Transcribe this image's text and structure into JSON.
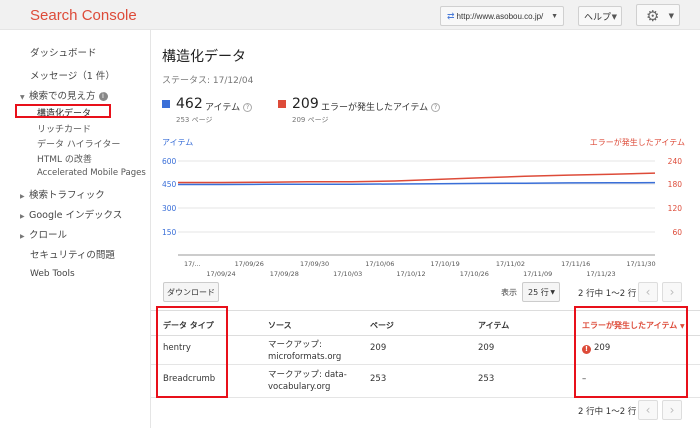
{
  "header": {
    "logo": "Search Console",
    "site": "http://www.asobou.co.jp/",
    "help": "ヘルプ"
  },
  "sidebar": {
    "items": [
      {
        "label": "ダッシュボード"
      },
      {
        "label": "メッセージ（1 件）"
      },
      {
        "label": "検索での見え方",
        "expanded": true
      },
      {
        "label": "構造化データ",
        "active": true
      },
      {
        "label": "リッチカード"
      },
      {
        "label": "データ ハイライター"
      },
      {
        "label": "HTML の改善"
      },
      {
        "label": "Accelerated Mobile Pages"
      },
      {
        "label": "検索トラフィック"
      },
      {
        "label": "Google インデックス"
      },
      {
        "label": "クロール"
      },
      {
        "label": "セキュリティの問題"
      },
      {
        "label": "Web Tools"
      }
    ]
  },
  "page": {
    "title": "構造化データ",
    "status": "ステータス: 17/12/04"
  },
  "metrics": {
    "items": {
      "value": "462",
      "label": "アイテム",
      "sub": "253 ページ",
      "color": "#3a6fd8"
    },
    "errors": {
      "value": "209",
      "label": "エラーが発生したアイテム",
      "sub": "209 ページ",
      "color": "#dd4b39"
    }
  },
  "chart_data": {
    "type": "line",
    "legend": [
      "アイテム",
      "エラーが発生したアイテム"
    ],
    "left_axis": [
      "600",
      "450",
      "300",
      "150"
    ],
    "right_axis": [
      "240",
      "180",
      "120",
      "60"
    ],
    "x_top": [
      "17/...",
      "17/09/26",
      "17/09/30",
      "17/10/06",
      "17/10/19",
      "17/11/02",
      "17/11/16",
      "17/11/30"
    ],
    "x_bottom": [
      "17/09/24",
      "17/09/28",
      "17/10/03",
      "17/10/12",
      "17/10/26",
      "17/11/09",
      "17/11/23"
    ],
    "series": [
      {
        "name": "アイテム",
        "color": "#3a6fd8",
        "values": [
          450,
          450,
          451,
          452,
          452,
          453,
          455,
          457,
          458,
          460,
          461,
          462
        ]
      },
      {
        "name": "エラーが発生したアイテム",
        "color": "#dd4b39",
        "values": [
          185,
          185,
          186,
          187,
          187,
          189,
          193,
          197,
          201,
          204,
          206,
          209
        ]
      }
    ]
  },
  "controls": {
    "download": "ダウンロード",
    "show_label": "表示",
    "rows": "25 行",
    "range": "2 行中 1〜2 行"
  },
  "table": {
    "headers": [
      "データ タイプ",
      "ソース",
      "ページ",
      "アイテム",
      "エラーが発生したアイテム"
    ],
    "rows": [
      {
        "type": "hentry",
        "source1": "マークアップ:",
        "source2": "microformats.org",
        "pages": "209",
        "items": "209",
        "errors": "209"
      },
      {
        "type": "Breadcrumb",
        "source1": "マークアップ: data-",
        "source2": "vocabulary.org",
        "pages": "253",
        "items": "253",
        "errors": "–"
      }
    ]
  }
}
